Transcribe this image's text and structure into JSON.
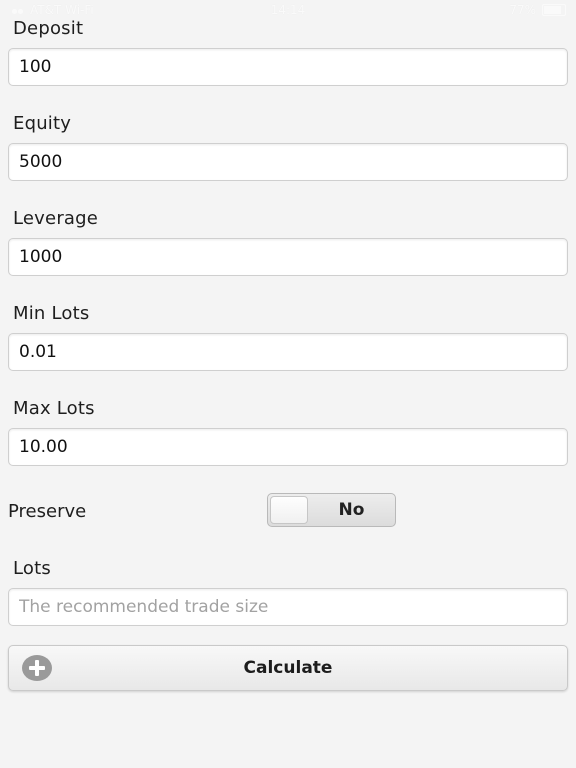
{
  "status_bar": {
    "carrier": "AT&T Wi-Fi",
    "time": "14:14",
    "battery": "77%"
  },
  "form": {
    "deposit": {
      "label": "Deposit",
      "value": "100"
    },
    "equity": {
      "label": "Equity",
      "value": "5000"
    },
    "leverage": {
      "label": "Leverage",
      "value": "1000"
    },
    "min_lots": {
      "label": "Min Lots",
      "value": "0.01"
    },
    "max_lots": {
      "label": "Max Lots",
      "value": "10.00"
    },
    "preserve": {
      "label": "Preserve",
      "state": "No"
    },
    "lots": {
      "label": "Lots",
      "value": "",
      "placeholder": "The recommended trade size"
    }
  },
  "calculate_button": {
    "label": "Calculate",
    "icon": "plus-circle-icon"
  },
  "colors": {
    "background": "#f4f4f4",
    "field_background": "#ffffff",
    "icon_gray": "#9a9a9a"
  }
}
